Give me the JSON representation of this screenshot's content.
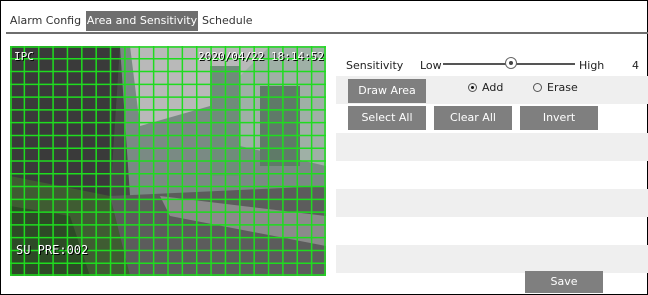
{
  "tabs": [
    {
      "label": "Alarm Config",
      "active": false
    },
    {
      "label": "Area and Sensitivity",
      "active": true
    },
    {
      "label": "Schedule",
      "active": false
    }
  ],
  "video": {
    "timestamp": "2020/04/22 18:14:52",
    "camera_label": "IPC",
    "preset_label": "SU PRE:002",
    "grid_color": "#1fdc1f",
    "grid_columns": 22,
    "grid_rows": 18,
    "selected_all": true
  },
  "sensitivity": {
    "label": "Sensitivity",
    "low_label": "Low",
    "high_label": "High",
    "value": "4",
    "level_fraction": 0.52
  },
  "buttons": {
    "draw_area": "Draw Area",
    "select_all": "Select All",
    "clear_all": "Clear All",
    "invert": "Invert",
    "save": "Save"
  },
  "mode": {
    "add_label": "Add",
    "erase_label": "Erase",
    "selected": "add"
  },
  "colors": {
    "button_gray": "#7f7f7f",
    "active_tab": "#6e6e6e",
    "strip_gray": "#efefef"
  }
}
